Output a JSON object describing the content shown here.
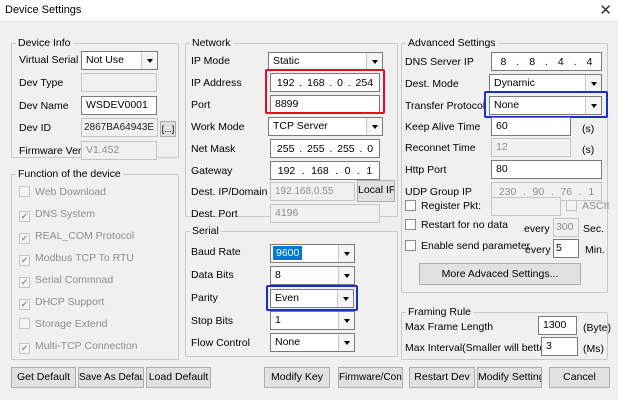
{
  "window": {
    "title": "Device Settings"
  },
  "device_info": {
    "legend": "Device Info",
    "virtual_serial_label": "Virtual Serial",
    "virtual_serial_value": "Not Use",
    "dev_type_label": "Dev Type",
    "dev_type_value": "",
    "dev_name_label": "Dev Name",
    "dev_name_value": "WSDEV0001",
    "dev_id_label": "Dev ID",
    "dev_id_value": "2867BA64943E",
    "dev_id_button": "[...]",
    "firmware_label": "Firmware Ver",
    "firmware_value": "V1.452"
  },
  "functions": {
    "legend": "Function of the device",
    "items": [
      {
        "label": "Web Download",
        "checked": false
      },
      {
        "label": "DNS System",
        "checked": true
      },
      {
        "label": "REAL_COM Protocol",
        "checked": true
      },
      {
        "label": "Modbus TCP To RTU",
        "checked": true
      },
      {
        "label": "Serial Commnad",
        "checked": true
      },
      {
        "label": "DHCP Support",
        "checked": true
      },
      {
        "label": "Storage Extend",
        "checked": false
      },
      {
        "label": "Multi-TCP Connection",
        "checked": true
      }
    ]
  },
  "network": {
    "legend": "Network",
    "ip_mode_label": "IP Mode",
    "ip_mode_value": "Static",
    "ip_address_label": "IP Address",
    "ip_address": [
      "192",
      "168",
      "0",
      "254"
    ],
    "port_label": "Port",
    "port_value": "8899",
    "work_mode_label": "Work Mode",
    "work_mode_value": "TCP Server",
    "net_mask_label": "Net Mask",
    "net_mask": [
      "255",
      "255",
      "255",
      "0"
    ],
    "gateway_label": "Gateway",
    "gateway": [
      "192",
      "168",
      "0",
      "1"
    ],
    "dest_ip_label": "Dest. IP/Domain",
    "dest_ip_value": "192.168.0.55",
    "local_ip_button": "Local IP",
    "dest_port_label": "Dest. Port",
    "dest_port_value": "4196"
  },
  "serial": {
    "legend": "Serial",
    "baud_rate_label": "Baud Rate",
    "baud_rate_value": "9600",
    "data_bits_label": "Data Bits",
    "data_bits_value": "8",
    "parity_label": "Parity",
    "parity_value": "Even",
    "stop_bits_label": "Stop Bits",
    "stop_bits_value": "1",
    "flow_control_label": "Flow Control",
    "flow_control_value": "None"
  },
  "advanced": {
    "legend": "Advanced Settings",
    "dns_label": "DNS Server IP",
    "dns": [
      "8",
      "8",
      "4",
      "4"
    ],
    "dest_mode_label": "Dest. Mode",
    "dest_mode_value": "Dynamic",
    "transfer_label": "Transfer Protocol",
    "transfer_value": "None",
    "keep_alive_label": "Keep Alive Time",
    "keep_alive_value": "60",
    "keep_alive_unit": "(s)",
    "reconnet_label": "Reconnet Time",
    "reconnet_value": "12",
    "reconnet_unit": "(s)",
    "http_port_label": "Http Port",
    "http_port_value": "80",
    "udp_group_label": "UDP Group IP",
    "udp_group": [
      "230",
      "90",
      "76",
      "1"
    ],
    "register_label": "Register Pkt:",
    "ascii_label": "ASCII",
    "restart_label": "Restart for no data",
    "restart_every": "every",
    "restart_value": "300",
    "restart_unit": "Sec.",
    "enable_send_label": "Enable send parameter",
    "send_every": "every",
    "send_value": "5",
    "send_unit": "Min.",
    "more_button": "More Advaced Settings..."
  },
  "framing": {
    "legend": "Framing Rule",
    "max_frame_label": "Max Frame Length",
    "max_frame_value": "1300",
    "max_frame_unit": "(Byte)",
    "max_interval_label": "Max Interval(Smaller will better)",
    "max_interval_value": "3",
    "max_interval_unit": "(Ms)"
  },
  "buttons": {
    "get_default": "Get Default",
    "save_default": "Save As Default",
    "load_default": "Load Default",
    "modify_key": "Modify Key",
    "firmware_config": "Firmware/Config",
    "restart_dev": "Restart Dev",
    "modify_setting": "Modify Setting",
    "cancel": "Cancel"
  }
}
